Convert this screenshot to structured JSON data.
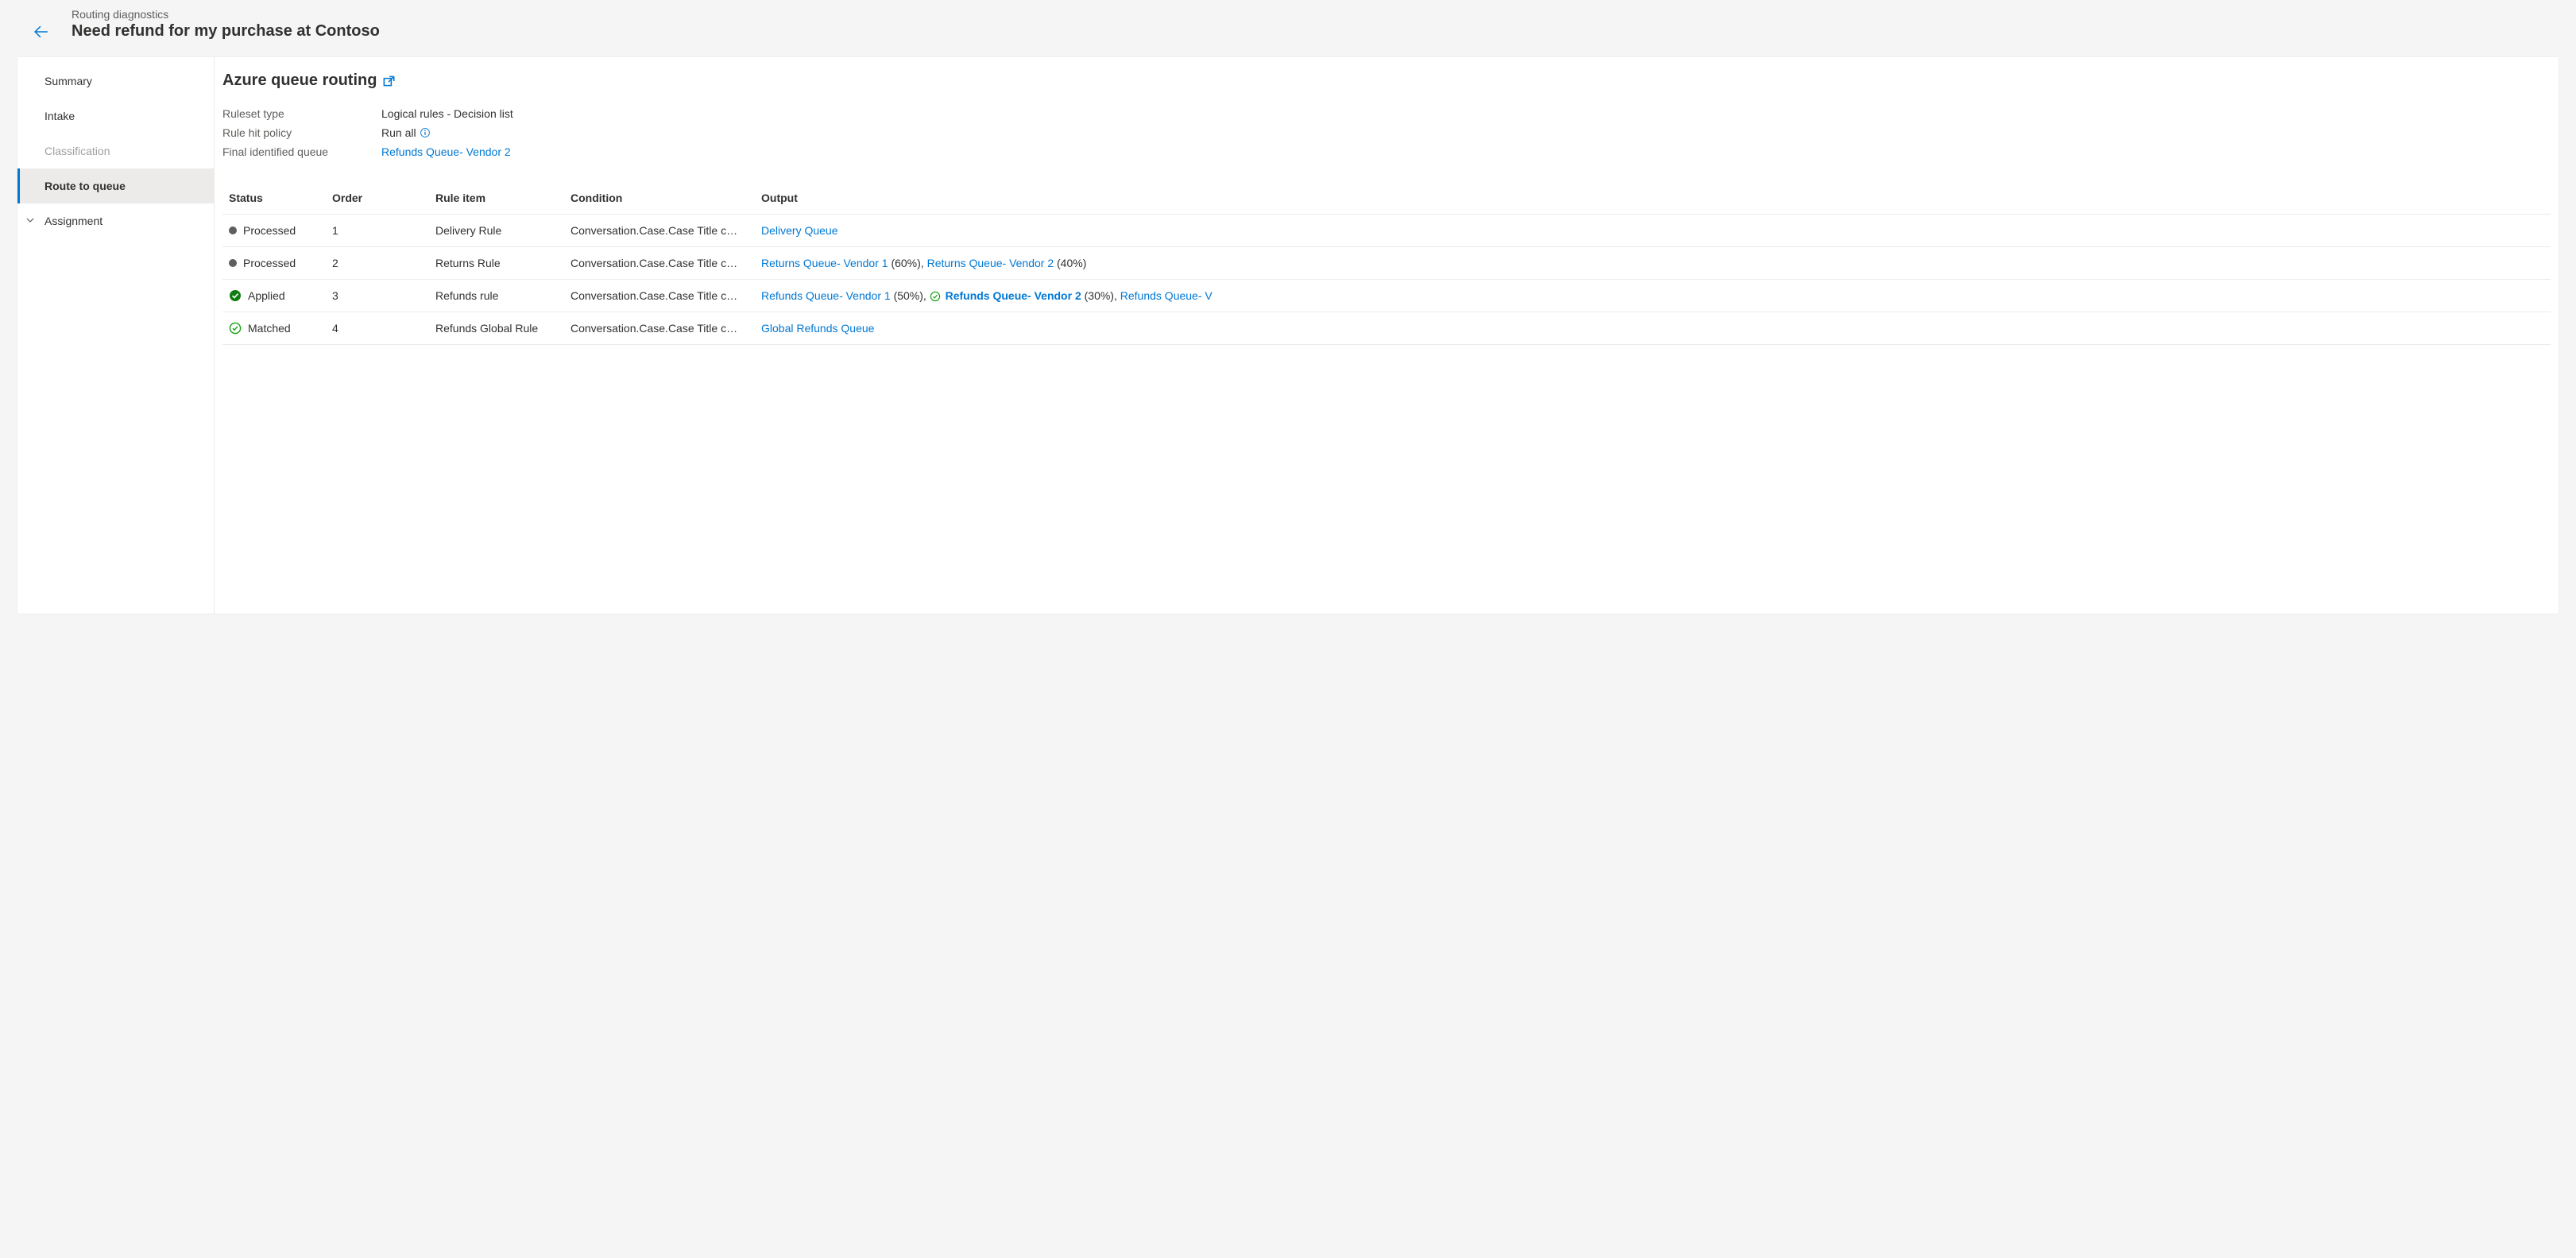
{
  "header": {
    "breadcrumb": "Routing diagnostics",
    "title": "Need refund for my purchase at Contoso"
  },
  "sidebar": {
    "items": [
      {
        "label": "Summary",
        "selected": false,
        "disabled": false,
        "chevron": false
      },
      {
        "label": "Intake",
        "selected": false,
        "disabled": false,
        "chevron": false
      },
      {
        "label": "Classification",
        "selected": false,
        "disabled": true,
        "chevron": false
      },
      {
        "label": "Route to queue",
        "selected": true,
        "disabled": false,
        "chevron": false
      },
      {
        "label": "Assignment",
        "selected": false,
        "disabled": false,
        "chevron": true
      }
    ]
  },
  "main": {
    "heading": "Azure queue routing",
    "meta": {
      "ruleset_type_label": "Ruleset type",
      "ruleset_type_value": "Logical rules - Decision list",
      "rule_hit_policy_label": "Rule hit policy",
      "rule_hit_policy_value": "Run all",
      "final_queue_label": "Final identified queue",
      "final_queue_value": "Refunds Queue- Vendor 2"
    },
    "columns": {
      "status": "Status",
      "order": "Order",
      "rule_item": "Rule item",
      "condition": "Condition",
      "output": "Output"
    },
    "rows": [
      {
        "status_type": "processed",
        "status_label": "Processed",
        "order": "1",
        "rule_item": "Delivery Rule",
        "condition": "Conversation.Case.Case Title c…",
        "outputs": [
          {
            "name": "Delivery Queue",
            "pct": "",
            "highlight": false
          }
        ]
      },
      {
        "status_type": "processed",
        "status_label": "Processed",
        "order": "2",
        "rule_item": "Returns Rule",
        "condition": "Conversation.Case.Case Title c…",
        "outputs": [
          {
            "name": "Returns Queue- Vendor 1",
            "pct": "(60%)",
            "highlight": false
          },
          {
            "name": "Returns Queue- Vendor 2",
            "pct": "(40%)",
            "highlight": false
          }
        ]
      },
      {
        "status_type": "applied",
        "status_label": "Applied",
        "order": "3",
        "rule_item": "Refunds rule",
        "condition": "Conversation.Case.Case Title c…",
        "outputs": [
          {
            "name": "Refunds Queue- Vendor 1",
            "pct": "(50%)",
            "highlight": false
          },
          {
            "name": "Refunds Queue- Vendor 2",
            "pct": "(30%)",
            "highlight": true
          },
          {
            "name": "Refunds Queue- V",
            "pct": "",
            "highlight": false
          }
        ]
      },
      {
        "status_type": "matched",
        "status_label": "Matched",
        "order": "4",
        "rule_item": "Refunds Global Rule",
        "condition": "Conversation.Case.Case Title c…",
        "outputs": [
          {
            "name": "Global Refunds Queue",
            "pct": "",
            "highlight": false
          }
        ]
      }
    ]
  }
}
